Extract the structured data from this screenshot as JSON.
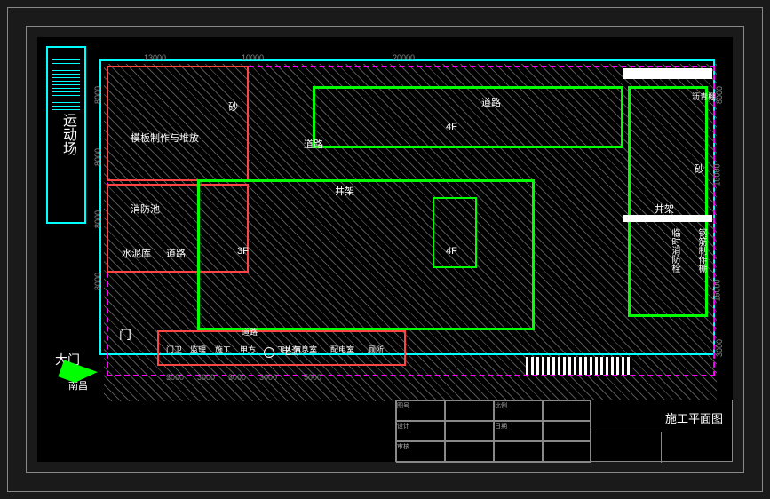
{
  "title_block": {
    "main_title": "施工平面图",
    "rows": [
      {
        "c1": "图号",
        "c2": "",
        "c3": "比例",
        "c4": ""
      },
      {
        "c1": "设计",
        "c2": "",
        "c3": "日期",
        "c4": ""
      },
      {
        "c1": "审核",
        "c2": "",
        "c3": "",
        "c4": ""
      }
    ]
  },
  "left_area": {
    "label": "运动场"
  },
  "gates": {
    "small_gate": "门",
    "main_gate": "大门",
    "direction": "南昌"
  },
  "rooms": {
    "muban": "模板制作与堆放",
    "sha1": "砂",
    "xiaofang": "消防池",
    "shuini": "水泥库",
    "daolu1": "道路",
    "daolu2": "道路",
    "daolu3": "道路",
    "menwei": "门卫",
    "jianli": "监理",
    "shigong": "施工",
    "jiafang": "甲方",
    "gongren": "工人休息室",
    "peidian": "配电室",
    "cesuo": "厕所",
    "dianyuan": "电源",
    "bldg_3f": "3F",
    "bldg_4f_a": "4F",
    "bldg_4f_b": "4F",
    "jingjia": "井架",
    "jingjia2": "井架",
    "liqing": "沥青棚",
    "sha2": "砂",
    "linshi": "临时消防栓",
    "gangjin": "钢筋制作棚"
  },
  "dimensions": {
    "top_dims": [
      "13000",
      "10000",
      "20000"
    ],
    "left_dims": [
      "8000",
      "8000",
      "8000",
      "8000"
    ],
    "bottom_dims": [
      "3000",
      "3000",
      "3000",
      "3000",
      "5000"
    ],
    "right_dims": [
      "8000",
      "10000",
      "15000",
      "3000"
    ]
  }
}
